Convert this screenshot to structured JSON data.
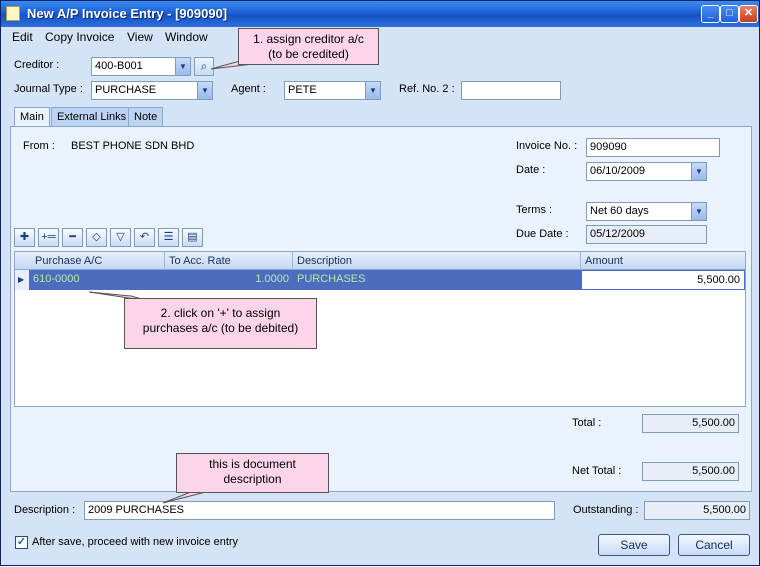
{
  "window": {
    "title": "New A/P Invoice Entry - [909090]",
    "controls": {
      "minimize": "_",
      "maximize": "□",
      "close": "✕"
    }
  },
  "menu": [
    "Edit",
    "Copy Invoice",
    "View",
    "Window"
  ],
  "header": {
    "creditor_label": "Creditor :",
    "creditor_value": "400-B001",
    "journal_type_label": "Journal Type :",
    "journal_type_value": "PURCHASE",
    "agent_label": "Agent :",
    "agent_value": "PETE",
    "ref_no2_label": "Ref. No. 2 :",
    "ref_no2_value": ""
  },
  "tabs": [
    "Main",
    "External Links",
    "Note"
  ],
  "main": {
    "from_label": "From :",
    "from_value": "BEST PHONE SDN BHD",
    "invoice_no_label": "Invoice No. :",
    "invoice_no_value": "909090",
    "date_label": "Date :",
    "date_value": "06/10/2009",
    "terms_label": "Terms :",
    "terms_value": "Net 60 days",
    "due_date_label": "Due Date :",
    "due_date_value": "05/12/2009"
  },
  "toolbar_icons": [
    "add-icon",
    "insert-icon",
    "delete-icon",
    "move-up-icon",
    "move-down-icon",
    "undo-icon",
    "list-icon",
    "detail-icon"
  ],
  "grid": {
    "columns": [
      "Purchase A/C",
      "To Acc. Rate",
      "Description",
      "Amount"
    ],
    "rows": [
      {
        "purchase_ac": "610-0000",
        "rate": "1.0000",
        "description": "PURCHASES",
        "amount": "5,500.00"
      }
    ]
  },
  "totals": {
    "total_label": "Total :",
    "total_value": "5,500.00",
    "net_total_label": "Net Total :",
    "net_total_value": "5,500.00",
    "outstanding_label": "Outstanding :",
    "outstanding_value": "5,500.00"
  },
  "footer": {
    "description_label": "Description :",
    "description_value": "2009 PURCHASES",
    "proceed_label": "After save, proceed with new invoice entry",
    "proceed_checked": true,
    "save_label": "Save",
    "cancel_label": "Cancel"
  },
  "callouts": {
    "creditor": "1. assign creditor a/c\n(to be credited)",
    "purchase": "2. click on '+' to assign\npurchases a/c (to be debited)",
    "description": "this is document\ndescription"
  },
  "colors": {
    "title_bar": "#1d5fd6",
    "selected_row": "#4b6dbd",
    "callout_fill": "#fcd5ea"
  }
}
